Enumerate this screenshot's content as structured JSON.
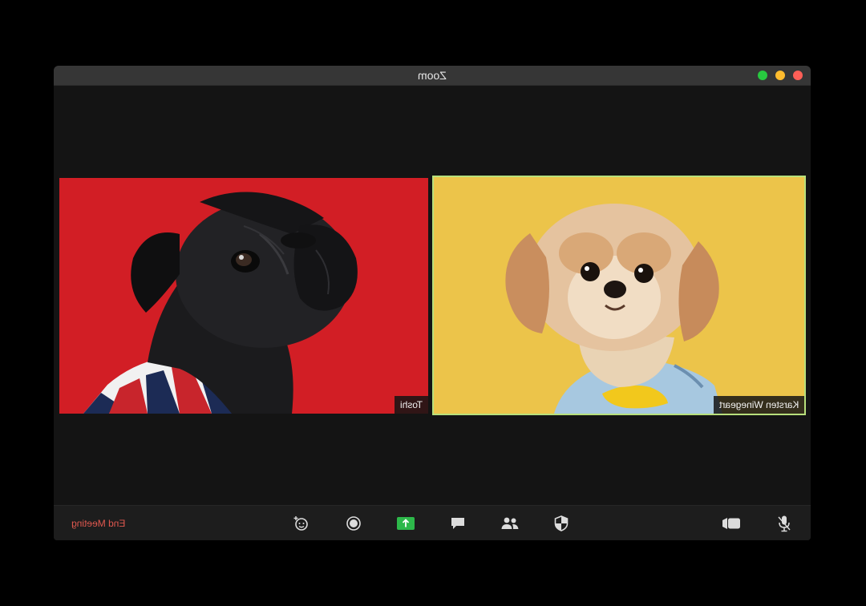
{
  "window": {
    "title": "Zoom",
    "controls": [
      "green-dot",
      "yellow-dot",
      "red-dot"
    ]
  },
  "participants": [
    {
      "name": "Toshi",
      "active_speaker": false,
      "video": "black pug in striped sweater on red background"
    },
    {
      "name": "Karsten Winegeart",
      "active_speaker": true,
      "video": "fluffy tan dog in blue shirt on yellow background"
    }
  ],
  "toolbar": {
    "end_meeting_label": "End Meeting",
    "buttons": [
      "reactions-icon",
      "record-icon",
      "share-screen-icon",
      "chat-icon",
      "participants-icon",
      "security-icon",
      "video-camera-icon",
      "microphone-icon"
    ]
  },
  "colors": {
    "left_background": "#d21e25",
    "right_background": "#ecc44a",
    "active_speaker_border": "#b8e07c",
    "share_button": "#2db84a",
    "end_meeting": "#e0584f"
  }
}
